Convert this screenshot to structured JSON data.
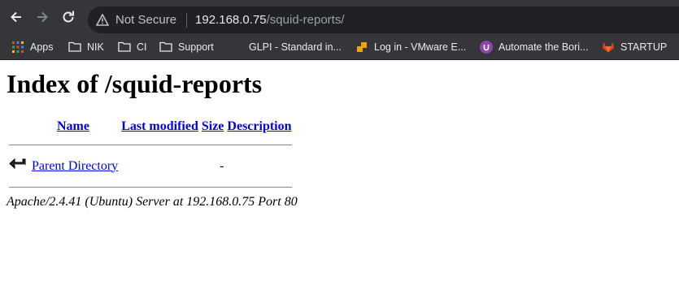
{
  "browser": {
    "security_label": "Not Secure",
    "url_host": "192.168.0.75",
    "url_path": "/squid-reports/"
  },
  "bookmarks": [
    {
      "label": "Apps",
      "icon": "apps-grid-icon"
    },
    {
      "label": "NIK",
      "icon": "folder-icon"
    },
    {
      "label": "CI",
      "icon": "folder-icon"
    },
    {
      "label": "Support",
      "icon": "folder-icon"
    },
    {
      "label": "GLPI - Standard in...",
      "icon": "none"
    },
    {
      "label": "Log in - VMware E...",
      "icon": "vmware-icon"
    },
    {
      "label": "Automate the Bori...",
      "icon": "purple-logo-icon"
    },
    {
      "label": "STARTUP",
      "icon": "gitlab-icon"
    }
  ],
  "page": {
    "title": "Index of /squid-reports",
    "columns": {
      "name": "Name",
      "last_modified": "Last modified",
      "size": "Size",
      "description": "Description"
    },
    "rows": [
      {
        "name": "Parent Directory",
        "last_modified": "",
        "size": "-",
        "description": ""
      }
    ],
    "footer": "Apache/2.4.41 (Ubuntu) Server at 192.168.0.75 Port 80"
  }
}
